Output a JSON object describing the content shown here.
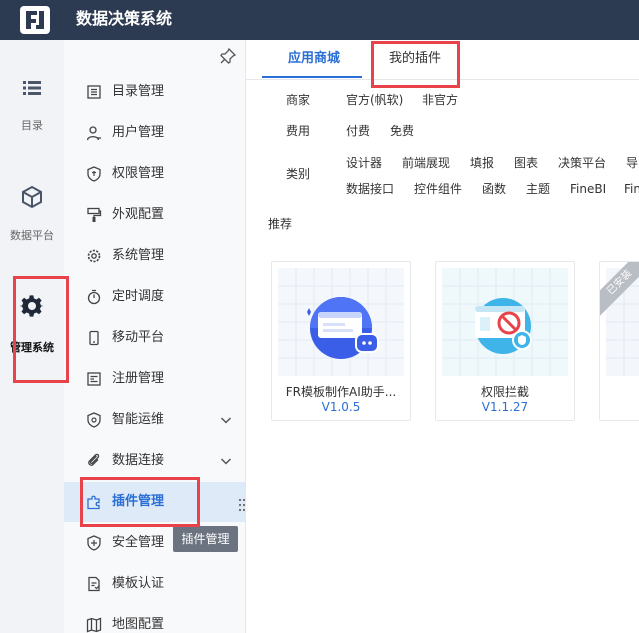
{
  "app": {
    "title": "数据决策系统"
  },
  "rail": [
    {
      "label": "目录",
      "icon": "list-icon"
    },
    {
      "label": "数据平台",
      "icon": "cube-icon"
    },
    {
      "label": "管理系统",
      "icon": "gear-icon"
    }
  ],
  "sidebar": {
    "items": [
      {
        "label": "目录管理",
        "icon": "catalog-icon"
      },
      {
        "label": "用户管理",
        "icon": "user-icon"
      },
      {
        "label": "权限管理",
        "icon": "shield-icon"
      },
      {
        "label": "外观配置",
        "icon": "paint-icon"
      },
      {
        "label": "系统管理",
        "icon": "settings-icon"
      },
      {
        "label": "定时调度",
        "icon": "timer-icon"
      },
      {
        "label": "移动平台",
        "icon": "phone-icon"
      },
      {
        "label": "注册管理",
        "icon": "register-icon"
      },
      {
        "label": "智能运维",
        "icon": "ops-icon"
      },
      {
        "label": "数据连接",
        "icon": "link-icon"
      },
      {
        "label": "插件管理",
        "icon": "plugin-icon"
      },
      {
        "label": "安全管理",
        "icon": "security-icon"
      },
      {
        "label": "模板认证",
        "icon": "template-icon"
      },
      {
        "label": "地图配置",
        "icon": "map-icon"
      }
    ],
    "active_label": "插件管理"
  },
  "tooltip": {
    "text": "插件管理"
  },
  "tabs": [
    {
      "label": "应用商城"
    },
    {
      "label": "我的插件"
    }
  ],
  "filters": {
    "vendor": {
      "label": "商家",
      "options": [
        "官方(帆软)",
        "非官方"
      ]
    },
    "fee": {
      "label": "费用",
      "options": [
        "付费",
        "免费"
      ]
    },
    "category": {
      "label": "类别",
      "row1": [
        "设计器",
        "前端展现",
        "填报",
        "图表",
        "决策平台",
        "导"
      ],
      "row2": [
        "数据接口",
        "控件组件",
        "函数",
        "主题",
        "FineBI",
        "Fin"
      ]
    }
  },
  "recommend": {
    "title": "推荐"
  },
  "cards": [
    {
      "name": "FR模板制作AI助手...",
      "version": "V1.0.5"
    },
    {
      "name": "权限拦截",
      "version": "V1.1.27"
    },
    {
      "name": "",
      "version": "",
      "ribbon": "已安装"
    }
  ],
  "colors": {
    "topbar": "#2d3b52",
    "accent": "#2a6fd6",
    "highlight": "#e8434a",
    "active_bg": "#dfeaf8"
  }
}
